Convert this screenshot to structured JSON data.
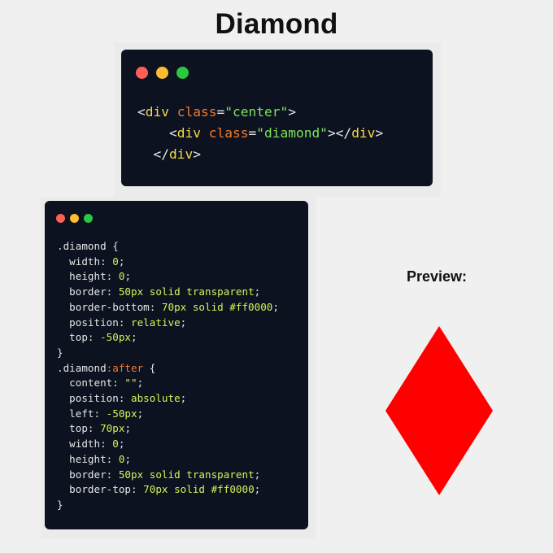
{
  "title": "Diamond",
  "html_card": {
    "lines": [
      {
        "indent": "",
        "parts": [
          {
            "t": "<",
            "c": "punct"
          },
          {
            "t": "div",
            "c": "tag"
          },
          {
            "t": " ",
            "c": "punct"
          },
          {
            "t": "class",
            "c": "attr"
          },
          {
            "t": "=",
            "c": "punct"
          },
          {
            "t": "\"center\"",
            "c": "str"
          },
          {
            "t": ">",
            "c": "punct"
          }
        ]
      },
      {
        "indent": "    ",
        "parts": [
          {
            "t": "<",
            "c": "punct"
          },
          {
            "t": "div",
            "c": "tag"
          },
          {
            "t": " ",
            "c": "punct"
          },
          {
            "t": "class",
            "c": "attr"
          },
          {
            "t": "=",
            "c": "punct"
          },
          {
            "t": "\"diamond\"",
            "c": "str"
          },
          {
            "t": "></",
            "c": "punct"
          },
          {
            "t": "div",
            "c": "tag"
          },
          {
            "t": ">",
            "c": "punct"
          }
        ]
      },
      {
        "indent": "  ",
        "parts": [
          {
            "t": "</",
            "c": "punct"
          },
          {
            "t": "div",
            "c": "tag"
          },
          {
            "t": ">",
            "c": "punct"
          }
        ]
      }
    ]
  },
  "css_card": {
    "lines": [
      {
        "indent": "",
        "parts": [
          {
            "t": ".diamond {",
            "c": "sel"
          }
        ]
      },
      {
        "indent": "  ",
        "parts": [
          {
            "t": "width: ",
            "c": "prop"
          },
          {
            "t": "0",
            "c": "val"
          },
          {
            "t": ";",
            "c": "punct"
          }
        ]
      },
      {
        "indent": "  ",
        "parts": [
          {
            "t": "height: ",
            "c": "prop"
          },
          {
            "t": "0",
            "c": "val"
          },
          {
            "t": ";",
            "c": "punct"
          }
        ]
      },
      {
        "indent": "  ",
        "parts": [
          {
            "t": "border: ",
            "c": "prop"
          },
          {
            "t": "50px solid transparent",
            "c": "val"
          },
          {
            "t": ";",
            "c": "punct"
          }
        ]
      },
      {
        "indent": "  ",
        "parts": [
          {
            "t": "border-bottom: ",
            "c": "prop"
          },
          {
            "t": "70px solid #ff0000",
            "c": "val"
          },
          {
            "t": ";",
            "c": "punct"
          }
        ]
      },
      {
        "indent": "  ",
        "parts": [
          {
            "t": "position: ",
            "c": "prop"
          },
          {
            "t": "relative",
            "c": "val"
          },
          {
            "t": ";",
            "c": "punct"
          }
        ]
      },
      {
        "indent": "  ",
        "parts": [
          {
            "t": "top: ",
            "c": "prop"
          },
          {
            "t": "-50px",
            "c": "val"
          },
          {
            "t": ";",
            "c": "punct"
          }
        ]
      },
      {
        "indent": "",
        "parts": [
          {
            "t": "}",
            "c": "punct"
          }
        ]
      },
      {
        "indent": "",
        "parts": [
          {
            "t": ".diamond",
            "c": "sel"
          },
          {
            "t": ":after",
            "c": "pseudo"
          },
          {
            "t": " {",
            "c": "sel"
          }
        ]
      },
      {
        "indent": "  ",
        "parts": [
          {
            "t": "content: ",
            "c": "prop"
          },
          {
            "t": "\"\"",
            "c": "val"
          },
          {
            "t": ";",
            "c": "punct"
          }
        ]
      },
      {
        "indent": "  ",
        "parts": [
          {
            "t": "position: ",
            "c": "prop"
          },
          {
            "t": "absolute",
            "c": "val"
          },
          {
            "t": ";",
            "c": "punct"
          }
        ]
      },
      {
        "indent": "  ",
        "parts": [
          {
            "t": "left: ",
            "c": "prop"
          },
          {
            "t": "-50px",
            "c": "val"
          },
          {
            "t": ";",
            "c": "punct"
          }
        ]
      },
      {
        "indent": "  ",
        "parts": [
          {
            "t": "top: ",
            "c": "prop"
          },
          {
            "t": "70px",
            "c": "val"
          },
          {
            "t": ";",
            "c": "punct"
          }
        ]
      },
      {
        "indent": "  ",
        "parts": [
          {
            "t": "width: ",
            "c": "prop"
          },
          {
            "t": "0",
            "c": "val"
          },
          {
            "t": ";",
            "c": "punct"
          }
        ]
      },
      {
        "indent": "  ",
        "parts": [
          {
            "t": "height: ",
            "c": "prop"
          },
          {
            "t": "0",
            "c": "val"
          },
          {
            "t": ";",
            "c": "punct"
          }
        ]
      },
      {
        "indent": "  ",
        "parts": [
          {
            "t": "border: ",
            "c": "prop"
          },
          {
            "t": "50px solid transparent",
            "c": "val"
          },
          {
            "t": ";",
            "c": "punct"
          }
        ]
      },
      {
        "indent": "  ",
        "parts": [
          {
            "t": "border-top: ",
            "c": "prop"
          },
          {
            "t": "70px solid #ff0000",
            "c": "val"
          },
          {
            "t": ";",
            "c": "punct"
          }
        ]
      },
      {
        "indent": "",
        "parts": [
          {
            "t": "}",
            "c": "punct"
          }
        ]
      }
    ]
  },
  "preview": {
    "label": "Preview:",
    "shape_icon": "diamond-shape",
    "color": "#ff0000"
  },
  "colors": {
    "background": "#f0f0f0",
    "card": "#0d1220",
    "dot_red": "#ff5f57",
    "dot_yellow": "#febc2e",
    "dot_green": "#28c840"
  }
}
